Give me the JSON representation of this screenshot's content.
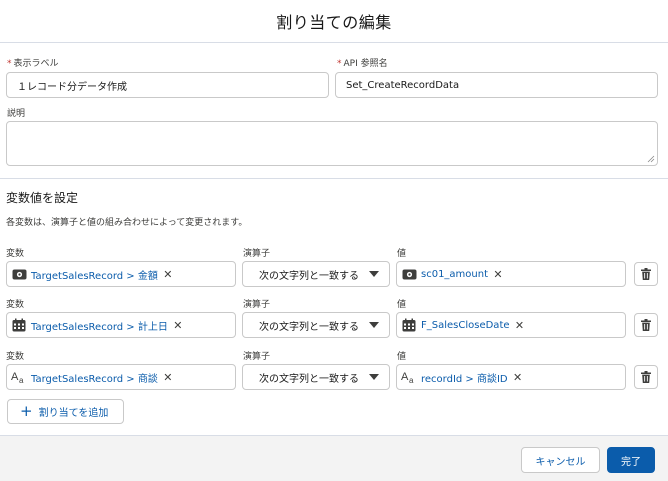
{
  "modal": {
    "title": "割り当ての編集"
  },
  "fields": {
    "label": {
      "label": "表示ラベル",
      "required": "*",
      "value": "１レコード分データ作成"
    },
    "api_name": {
      "label": "API 参照名",
      "required": "*",
      "value": "Set_CreateRecordData"
    },
    "description": {
      "label": "説明",
      "value": ""
    }
  },
  "section": {
    "title": "変数値を設定",
    "help": "各変数は、演算子と値の組み合わせによって変更されます。"
  },
  "column_headers": {
    "variable": "変数",
    "operator": "演算子",
    "value": "値"
  },
  "rows": [
    {
      "variable": {
        "icon": "currency-icon",
        "text": "TargetSalesRecord > 金額",
        "remove": "✕"
      },
      "operator": "次の文字列と一致する",
      "value": {
        "icon": "currency-icon",
        "text": "sc01_amount",
        "remove": "✕"
      }
    },
    {
      "variable": {
        "icon": "calendar-icon",
        "text": "TargetSalesRecord > 計上日",
        "remove": "✕"
      },
      "operator": "次の文字列と一致する",
      "value": {
        "icon": "calendar-icon",
        "text": "F_SalesCloseDate",
        "remove": "✕"
      }
    },
    {
      "variable": {
        "icon": "text-type-icon",
        "text": "TargetSalesRecord > 商談",
        "remove": "✕"
      },
      "operator": "次の文字列と一致する",
      "value": {
        "icon": "text-type-icon",
        "text": "recordId > 商談ID",
        "remove": "✕"
      }
    }
  ],
  "add_button": {
    "label": "割り当てを追加",
    "icon": "plus-icon"
  },
  "footer": {
    "cancel": "キャンセル",
    "done": "完了"
  },
  "colors": {
    "brand": "#0b5cab",
    "link": "#0b5cab",
    "border": "#c9c9c9",
    "footer_bg": "#f3f3f3",
    "required": "#c23934"
  }
}
